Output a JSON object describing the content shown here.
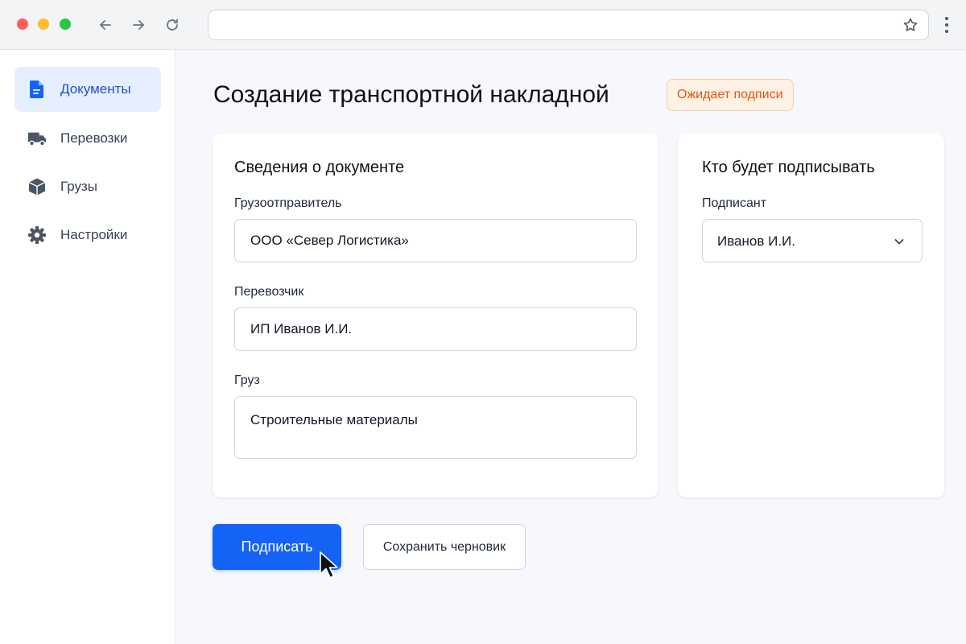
{
  "browser": {
    "url_value": ""
  },
  "sidebar": {
    "items": [
      {
        "label": "Документы",
        "icon": "document-icon",
        "active": true
      },
      {
        "label": "Перевозки",
        "icon": "truck-icon",
        "active": false
      },
      {
        "label": "Грузы",
        "icon": "box-icon",
        "active": false
      },
      {
        "label": "Настройки",
        "icon": "gear-icon",
        "active": false
      }
    ]
  },
  "main": {
    "title": "Создание транспортной накладной",
    "status": "Ожидает подписи",
    "document_card": {
      "title": "Сведения о документе",
      "fields": [
        {
          "label": "Грузоотправитель",
          "value": "ООО «Север Логистика»"
        },
        {
          "label": "Перевозчик",
          "value": "ИП Иванов И.И."
        },
        {
          "label": "Груз",
          "value": "Строительные материалы"
        }
      ]
    },
    "signer_card": {
      "title": "Кто будет подписывать",
      "signer_label": "Подписант",
      "signer_value": "Иванов И.И."
    },
    "actions": {
      "sign_label": "Подписать",
      "draft_label": "Сохранить черновик"
    }
  },
  "colors": {
    "accent": "#1463f5",
    "sidebar_active_bg": "#e6efff",
    "sidebar_active_text": "#1d4ed8",
    "badge_bg": "#fff1e6",
    "badge_text": "#e2550e"
  }
}
